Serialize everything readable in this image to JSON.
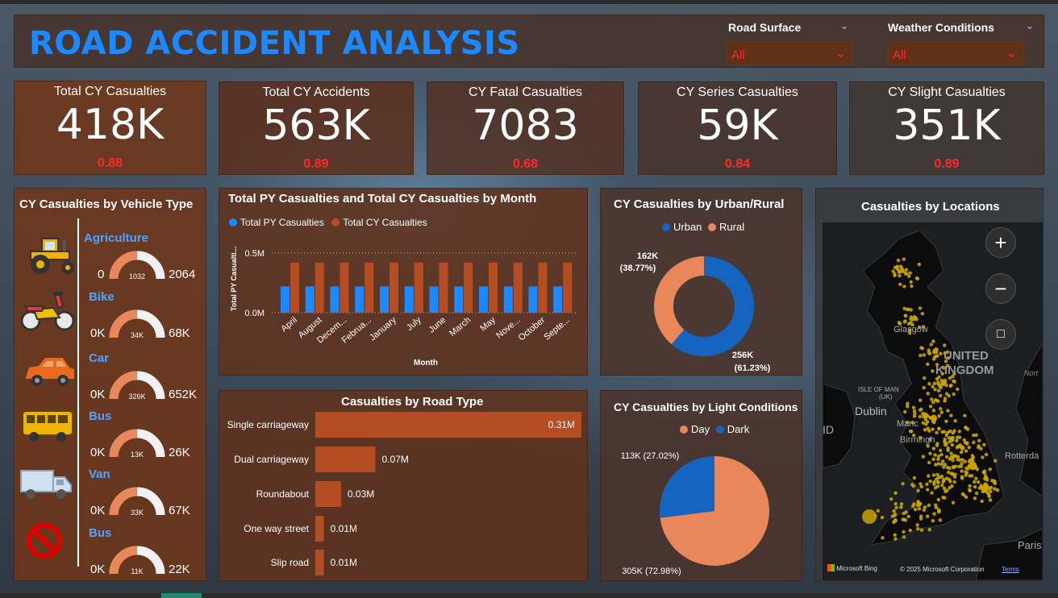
{
  "header": {
    "title": "ROAD ACCIDENT ANALYSIS"
  },
  "slicers": [
    {
      "label": "Road Surface",
      "value": "All"
    },
    {
      "label": "Weather Conditions",
      "value": "All"
    }
  ],
  "kpis": [
    {
      "label": "Total CY Casualties",
      "value": "418K",
      "ratio": "0.88"
    },
    {
      "label": "Total CY Accidents",
      "value": "563K",
      "ratio": "0.89"
    },
    {
      "label": "CY Fatal Casualties",
      "value": "7083",
      "ratio": "0.68"
    },
    {
      "label": "CY Series Casualties",
      "value": "59K",
      "ratio": "0.84"
    },
    {
      "label": "CY Slight Casualties",
      "value": "351K",
      "ratio": "0.89"
    }
  ],
  "vehicle_panel": {
    "title": "CY Casualties by Vehicle Type",
    "items": [
      {
        "name": "Agriculture",
        "icon": "tractor-icon",
        "min": "0",
        "value": "1032",
        "max": "2064",
        "fraction": 0.5
      },
      {
        "name": "Bike",
        "icon": "motorbike-icon",
        "min": "0K",
        "value": "34K",
        "max": "68K",
        "fraction": 0.5
      },
      {
        "name": "Car",
        "icon": "car-icon",
        "min": "0K",
        "value": "326K",
        "max": "652K",
        "fraction": 0.5
      },
      {
        "name": "Bus",
        "icon": "bus-icon",
        "min": "0K",
        "value": "13K",
        "max": "26K",
        "fraction": 0.5
      },
      {
        "name": "Van",
        "icon": "van-icon",
        "min": "0K",
        "value": "33K",
        "max": "67K",
        "fraction": 0.5
      },
      {
        "name": "Bus",
        "icon": "prohibited-icon",
        "min": "0K",
        "value": "11K",
        "max": "22K",
        "fraction": 0.5
      }
    ]
  },
  "map": {
    "title": "Casualties by Locations",
    "labels": [
      "Glasgow",
      "UNITED",
      "KINGDOM",
      "ISLE OF MAN",
      "(UK)",
      "Dublin",
      "Manc",
      "Birmingh",
      "Rotterda",
      "Paris",
      "Nort",
      "ID"
    ],
    "footer_brand": "Microsoft Bing",
    "footer_copyright": "© 2025 Microsoft Corporation",
    "footer_terms": "Terms",
    "dot_color": "#c9a400"
  },
  "colors": {
    "py_series": "#1e88ff",
    "cy_series": "#b44d22",
    "urban": "#1565c0",
    "rural": "#e8885a",
    "day": "#e8885a",
    "dark": "#1565c0",
    "bar": "#b44d22",
    "title_blue": "#1e88ff",
    "ratio_red": "#ff2a2a"
  },
  "chart_data": [
    {
      "id": "monthly",
      "type": "bar",
      "title": "Total PY Casualties and Total CY Casualties by Month",
      "xlabel": "Month",
      "ylabel": "Total PY Casualti...",
      "categories": [
        "April",
        "August",
        "Decem...",
        "Februa...",
        "January",
        "July",
        "June",
        "March",
        "May",
        "Nove...",
        "October",
        "Septe..."
      ],
      "yticks": [
        "0.0M",
        "0.5M"
      ],
      "ylim": [
        0,
        0.5
      ],
      "series": [
        {
          "name": "Total PY Casualties",
          "values": [
            0.22,
            0.22,
            0.22,
            0.22,
            0.22,
            0.22,
            0.22,
            0.22,
            0.22,
            0.22,
            0.22,
            0.22
          ]
        },
        {
          "name": "Total CY Casualties",
          "values": [
            0.42,
            0.42,
            0.42,
            0.42,
            0.42,
            0.42,
            0.42,
            0.42,
            0.42,
            0.42,
            0.42,
            0.42
          ]
        }
      ]
    },
    {
      "id": "urban_rural",
      "type": "pie",
      "title": "CY Casualties by Urban/Rural",
      "labels": [
        "Urban",
        "Rural"
      ],
      "values": [
        256,
        162
      ],
      "data_labels": [
        "256K (61.23%)",
        "162K (38.77%)"
      ]
    },
    {
      "id": "road_type",
      "type": "bar",
      "title": "Casualties by Road Type",
      "categories": [
        "Single carriageway",
        "Dual carriageway",
        "Roundabout",
        "One way street",
        "Slip road"
      ],
      "values": [
        0.31,
        0.07,
        0.03,
        0.01,
        0.01
      ],
      "data_labels": [
        "0.31M",
        "0.07M",
        "0.03M",
        "0.01M",
        "0.01M"
      ]
    },
    {
      "id": "light",
      "type": "pie",
      "title": "CY Casualties by Light Conditions",
      "labels": [
        "Day",
        "Dark"
      ],
      "values": [
        305,
        113
      ],
      "data_labels": [
        "305K (72.98%)",
        "113K (27.02%)"
      ]
    }
  ]
}
